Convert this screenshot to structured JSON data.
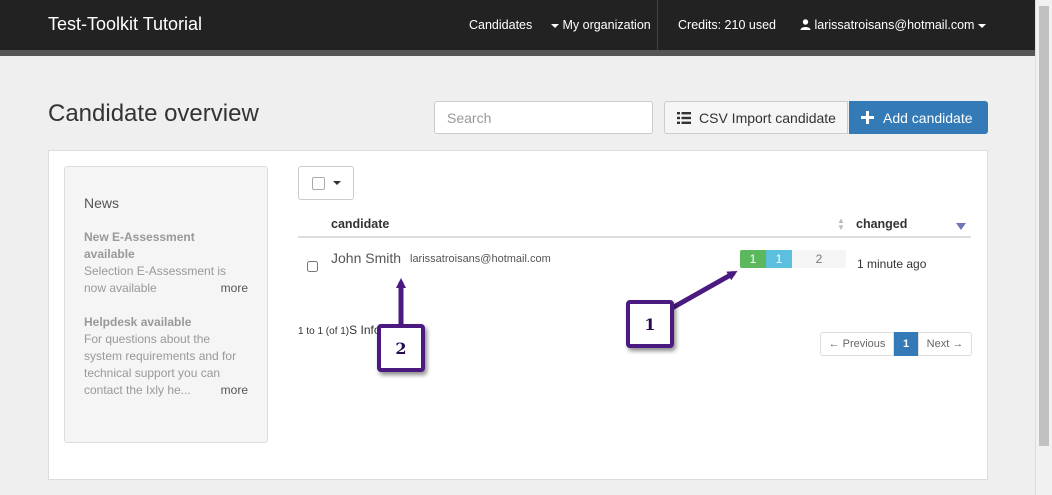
{
  "navbar": {
    "brand": "Test-Toolkit Tutorial",
    "candidates": "Candidates",
    "my_organization": "My organization",
    "credits": "Credits: 210 used",
    "user_email": "larissatroisans@hotmail.com"
  },
  "page": {
    "title": "Candidate overview",
    "search_placeholder": "Search",
    "csv_label": "CSV Import candidate",
    "add_label": "Add candidate"
  },
  "news": {
    "heading": "News",
    "items": [
      {
        "title": "New E-Assessment available",
        "body": "Selection E-Assessment is now available",
        "more": "more"
      },
      {
        "title": "Helpdesk available",
        "body": "For questions about the system requirements and for technical support you can contact the Ixly he...",
        "more": "more"
      }
    ]
  },
  "table": {
    "col_candidate": "candidate",
    "col_changed": "changed",
    "rows": [
      {
        "name": "John Smith",
        "email": "larissatroisans@hotmail.com",
        "progress": [
          "1",
          "1",
          "2"
        ],
        "changed": "1 minute ago"
      }
    ],
    "info_count": "1 to 1 (of 1)",
    "info_rest": "S Info",
    "pagination": {
      "prev": "← Previous",
      "current": "1",
      "next": "Next →"
    }
  },
  "annotations": [
    "1",
    "2"
  ],
  "colors": {
    "navbar": "#222222",
    "primary": "#337ab7",
    "progress_green": "#5cb85c",
    "progress_blue": "#5bc0de",
    "annotation": "#4b1a80"
  },
  "icons": [
    "caret-down-icon",
    "user-icon",
    "list-icon",
    "plus-icon",
    "sort-icon",
    "sort-down-icon"
  ]
}
